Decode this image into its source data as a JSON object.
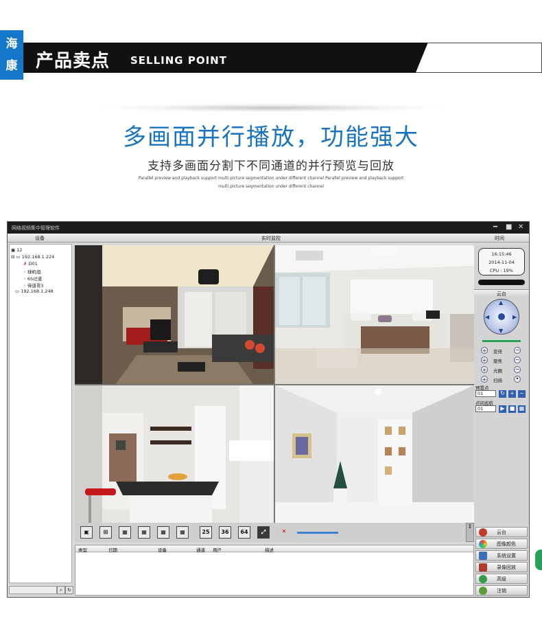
{
  "banner": {
    "brand_line1": "海",
    "brand_line2": "康",
    "title_cn": "产品卖点",
    "title_en": "SELLING POINT"
  },
  "intro": {
    "headline": "多画面并行播放，功能强大",
    "subhead": "支持多画面分割下不同通道的并行预览与回放",
    "fine1": "Parallel preview and playback support multi picture segmentation under different channel Parallel preview and playback support",
    "fine2": "multi picture segmentation under different channel"
  },
  "window": {
    "title": "网络视频集中管理软件",
    "col_device": "设备",
    "col_monitor": "实时监控",
    "col_time": "时间",
    "tree": [
      "12",
      "192.168.1.224",
      "D01",
      "球机组",
      "6S过道",
      "侍道哥3",
      "192.168.1.248"
    ],
    "clock": {
      "time": "16:15:46",
      "date": "2014-11-04",
      "cpu": "CPU : 19%"
    },
    "ptz_title": "云台",
    "ptz_rows": [
      "变倍",
      "聚焦",
      "光圈",
      "扫描"
    ],
    "preset_label": "预置点",
    "preset_value": "01",
    "cruise_label": "点间巡航",
    "cruise_value": "01",
    "layout_buttons": [
      "25",
      "36",
      "64"
    ],
    "log_headers": [
      "类型",
      "日期",
      "设备",
      "通道",
      "用户",
      "描述"
    ],
    "menu": [
      "云台",
      "图像颜色",
      "系统设置",
      "录像回放",
      "高级",
      "注销"
    ]
  },
  "colors": {
    "brand_blue": "#1577c9",
    "headline_blue": "#1a73bf",
    "banner_black": "#111111"
  }
}
